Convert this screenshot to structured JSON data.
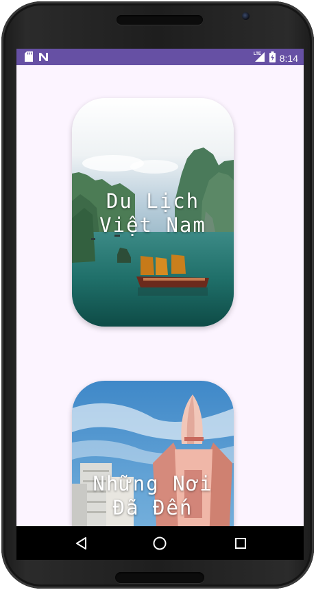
{
  "status_bar": {
    "time": "8:14",
    "network_label": "LTE",
    "left_icons": [
      "sd-card-icon",
      "no-signal-n-icon"
    ],
    "right_icons": [
      "lte-signal-icon",
      "battery-charging-icon"
    ],
    "color": "#6650a4"
  },
  "cards": [
    {
      "title": "Du Lịch\nViệt Nam",
      "image": "ha-long-bay-junk-boat"
    },
    {
      "title": "Những Nơi\nĐã Đến",
      "image": "nha-trang-tram-huong-tower"
    }
  ],
  "nav_bar": {
    "buttons": [
      "back-icon",
      "home-icon",
      "recent-apps-icon"
    ]
  },
  "colors": {
    "screen_background": "#fcf4ff",
    "status_bar": "#6650a4",
    "nav_bar": "#000000"
  }
}
